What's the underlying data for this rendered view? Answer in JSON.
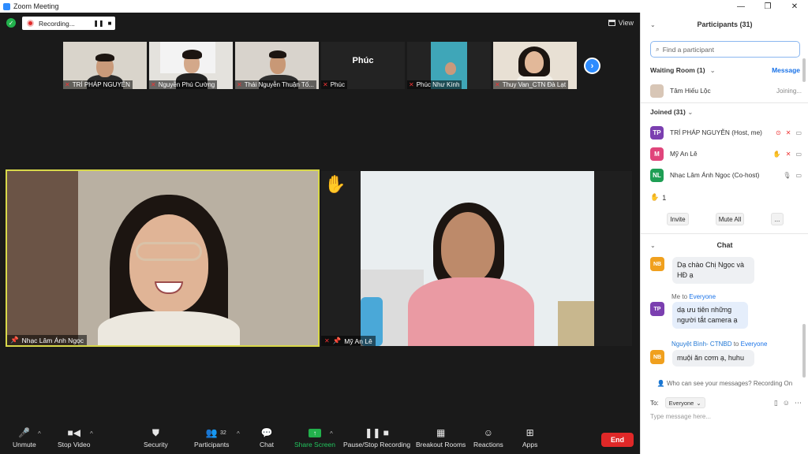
{
  "window": {
    "title": "Zoom Meeting",
    "minimize": "—",
    "restore": "❐",
    "close": "✕"
  },
  "recording": {
    "label": "Recording...",
    "pause": "❚❚",
    "stop": "■"
  },
  "view": {
    "label": "View"
  },
  "thumbnails": [
    {
      "name": "TRÍ PHÁP NGUYỄN"
    },
    {
      "name": "Nguyễn Phú Cường"
    },
    {
      "name": "Thái Nguyễn Thuận Tố..."
    },
    {
      "name": "Phúc",
      "big_label": "Phúc"
    },
    {
      "name": "Phúc Như Kính"
    },
    {
      "name": "Thuy Van_CTN Đà Lạt"
    }
  ],
  "main_videos": {
    "left_name": "Nhạc Lâm Ánh Ngọc",
    "right_name": "Mỹ An Lê",
    "hand": "✋"
  },
  "toolbar": {
    "unmute": "Unmute",
    "stop_video": "Stop Video",
    "security": "Security",
    "participants": "Participants",
    "participants_count": "32",
    "chat": "Chat",
    "share_screen": "Share Screen",
    "pause_stop_recording": "Pause/Stop Recording",
    "breakout_rooms": "Breakout Rooms",
    "reactions": "Reactions",
    "apps": "Apps",
    "end": "End"
  },
  "panel": {
    "title": "Participants (31)",
    "search_placeholder": "Find a participant",
    "waiting_room": "Waiting Room (1)",
    "message": "Message",
    "waiting": [
      {
        "name": "Tâm Hiếu Lộc",
        "status": "Joining..."
      }
    ],
    "joined_header": "Joined (31)",
    "joined": [
      {
        "initials": "TP",
        "name": "TRÍ PHÁP NGUYỄN (Host, me)",
        "color": "#7b3fb0"
      },
      {
        "initials": "M",
        "name": "Mỹ An Lê",
        "color": "#e0457b"
      },
      {
        "initials": "NL",
        "name": "Nhạc Lâm Ánh Ngọc (Co-host)",
        "color": "#1e9e54"
      }
    ],
    "hand_count": "1",
    "invite": "Invite",
    "mute_all": "Mute All",
    "more": "..."
  },
  "chat": {
    "title": "Chat",
    "messages": [
      {
        "initials": "NB",
        "text": "Dạ chào Chị Ngọc và HĐ ạ",
        "color": "#f0a01e"
      },
      {
        "from": "Me",
        "to_word": "to",
        "to": "Everyone",
        "initials": "TP",
        "text": "dạ ưu tiên những người tắt camera ạ",
        "color": "#7b3fb0"
      },
      {
        "from": "Nguyệt Bình- CTNBD",
        "to_word": "to",
        "to": "Everyone",
        "initials": "NB",
        "text": "muội ăn cơm ạ, huhu",
        "color": "#f0a01e"
      }
    ],
    "who_can_see": "Who can see your messages? Recording On",
    "to_label": "To:",
    "to_value": "Everyone",
    "input_placeholder": "Type message here..."
  },
  "colors": {
    "accent": "#2d8cff",
    "end": "#e02828",
    "share": "#22b14c",
    "active_speaker": "#d8d84a"
  }
}
